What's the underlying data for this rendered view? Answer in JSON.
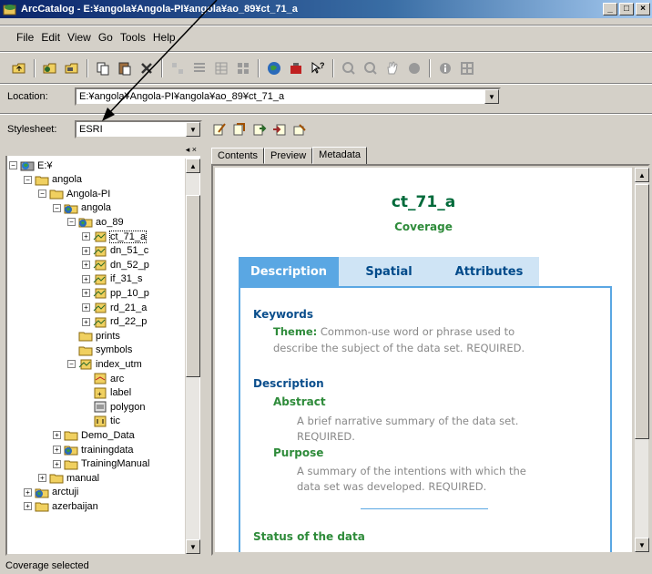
{
  "window": {
    "title": "ArcCatalog - E:¥angola¥Angola-PI¥angola¥ao_89¥ct_71_a",
    "buttons": [
      "_",
      "□",
      "×"
    ]
  },
  "menu": [
    "File",
    "Edit",
    "View",
    "Go",
    "Tools",
    "Help"
  ],
  "location": {
    "label": "Location:",
    "value": "E:¥angola¥Angola-PI¥angola¥ao_89¥ct_71_a"
  },
  "stylesheet": {
    "label": "Stylesheet:",
    "value": "ESRI"
  },
  "tree": [
    {
      "label": "E:¥",
      "depth": 0,
      "toggle": "-",
      "icon": "drive"
    },
    {
      "label": "angola",
      "depth": 1,
      "toggle": "-",
      "icon": "folder"
    },
    {
      "label": "Angola-PI",
      "depth": 2,
      "toggle": "-",
      "icon": "folder"
    },
    {
      "label": "angola",
      "depth": 3,
      "toggle": "-",
      "icon": "workspace"
    },
    {
      "label": "ao_89",
      "depth": 4,
      "toggle": "-",
      "icon": "workspace"
    },
    {
      "label": "ct_71_a",
      "depth": 5,
      "toggle": "+",
      "icon": "coverage",
      "selected": true
    },
    {
      "label": "dn_51_c",
      "depth": 5,
      "toggle": "+",
      "icon": "coverage"
    },
    {
      "label": "dn_52_p",
      "depth": 5,
      "toggle": "+",
      "icon": "coverage"
    },
    {
      "label": "if_31_s",
      "depth": 5,
      "toggle": "+",
      "icon": "coverage"
    },
    {
      "label": "pp_10_p",
      "depth": 5,
      "toggle": "+",
      "icon": "coverage"
    },
    {
      "label": "rd_21_a",
      "depth": 5,
      "toggle": "+",
      "icon": "coverage"
    },
    {
      "label": "rd_22_p",
      "depth": 5,
      "toggle": "+",
      "icon": "coverage"
    },
    {
      "label": "prints",
      "depth": 4,
      "toggle": "",
      "icon": "folder"
    },
    {
      "label": "symbols",
      "depth": 4,
      "toggle": "",
      "icon": "folder"
    },
    {
      "label": "index_utm",
      "depth": 4,
      "toggle": "-",
      "icon": "coverage"
    },
    {
      "label": "arc",
      "depth": 5,
      "toggle": "",
      "icon": "fc-arc"
    },
    {
      "label": "label",
      "depth": 5,
      "toggle": "",
      "icon": "fc-label"
    },
    {
      "label": "polygon",
      "depth": 5,
      "toggle": "",
      "icon": "fc-polygon"
    },
    {
      "label": "tic",
      "depth": 5,
      "toggle": "",
      "icon": "fc-tic"
    },
    {
      "label": "Demo_Data",
      "depth": 3,
      "toggle": "+",
      "icon": "folder"
    },
    {
      "label": "trainingdata",
      "depth": 3,
      "toggle": "+",
      "icon": "workspace"
    },
    {
      "label": "TrainingManual",
      "depth": 3,
      "toggle": "+",
      "icon": "folder"
    },
    {
      "label": "manual",
      "depth": 2,
      "toggle": "+",
      "icon": "folder"
    },
    {
      "label": "arctuji",
      "depth": 1,
      "toggle": "+",
      "icon": "workspace"
    },
    {
      "label": "azerbaijan",
      "depth": 1,
      "toggle": "+",
      "icon": "folder"
    }
  ],
  "tabs": [
    "Contents",
    "Preview",
    "Metadata"
  ],
  "active_tab": "Metadata",
  "metadata": {
    "title": "ct_71_a",
    "subtitle": "Coverage",
    "tabs": [
      "Description",
      "Spatial",
      "Attributes"
    ],
    "active_tab": "Description",
    "keywords_heading": "Keywords",
    "theme_label": "Theme:",
    "theme_text_1": " Common-use word or phrase used to",
    "theme_text_2": "describe the subject of the data set. REQUIRED.",
    "description_heading": "Description",
    "abstract_label": "Abstract",
    "abstract_text_1": "A brief narrative summary of the data set.",
    "abstract_text_2": "REQUIRED.",
    "purpose_label": "Purpose",
    "purpose_text_1": "A summary of the intentions with which the",
    "purpose_text_2": "data set was developed. REQUIRED.",
    "status_heading": "Status of the data"
  },
  "status": "Coverage selected",
  "colors": {
    "titlebar_start": "#0a246a",
    "metadata_green": "#006a3a",
    "metadata_blue_tab": "#5aa7e3",
    "section_blue": "#0a4e8c"
  }
}
